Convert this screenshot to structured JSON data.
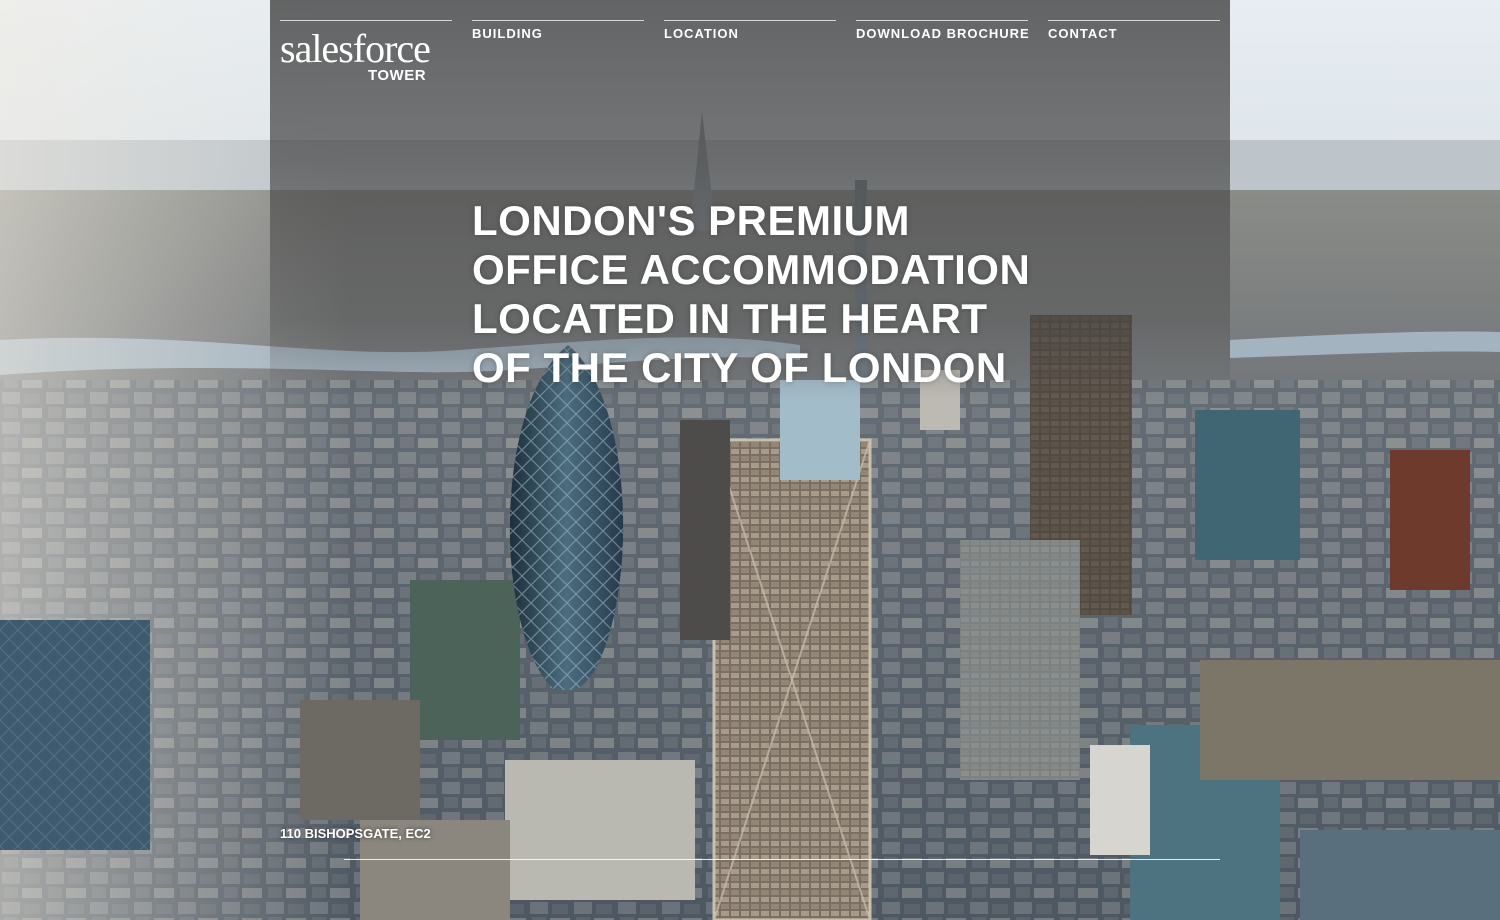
{
  "logo": {
    "line1": "salesforce",
    "line2": "TOWER"
  },
  "nav": {
    "items": [
      {
        "label": "BUILDING"
      },
      {
        "label": "LOCATION"
      },
      {
        "label": "DOWNLOAD BROCHURE"
      },
      {
        "label": "CONTACT"
      }
    ]
  },
  "hero": {
    "headline_lines": [
      "LONDON'S PREMIUM",
      "OFFICE ACCOMMODATION",
      "LOCATED IN THE HEART",
      "OF THE CITY OF LONDON"
    ]
  },
  "footer": {
    "address": "110 BISHOPSGATE, EC2"
  },
  "colors": {
    "sky": "#dfe7ee",
    "haze": "#b8c2c9",
    "city": "#5c6873",
    "river": "#9fb3c4",
    "overlay": "#464646",
    "text": "#ffffff"
  }
}
